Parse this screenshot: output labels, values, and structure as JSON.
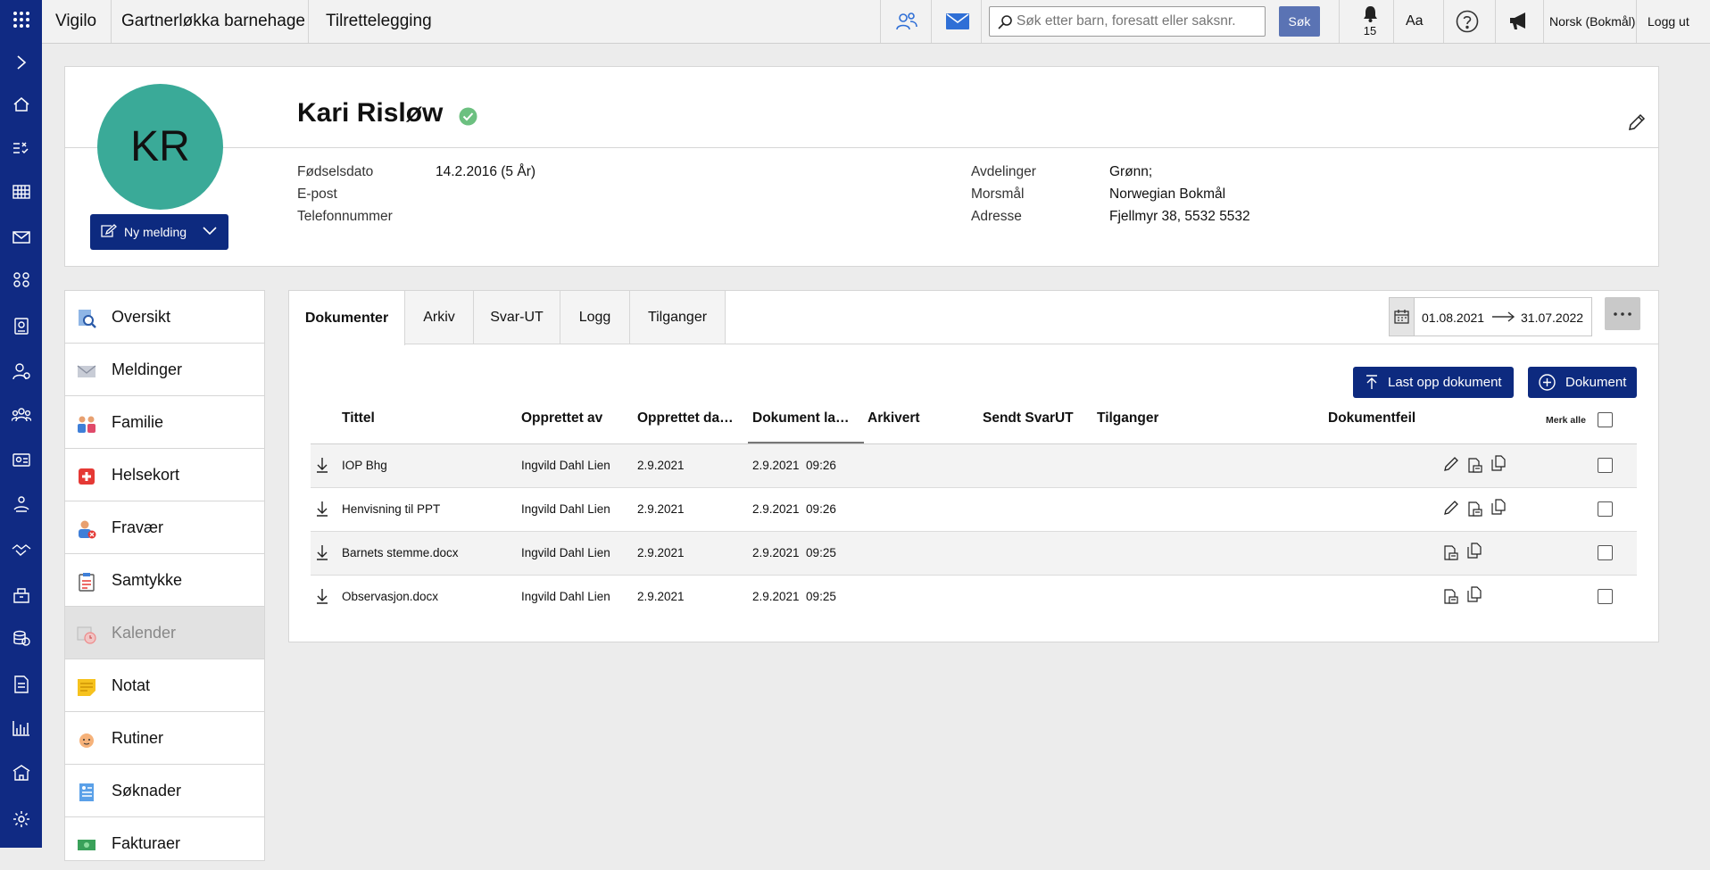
{
  "app": {
    "name": "Vigilo",
    "institution": "Gartnerløkka barnehage",
    "section": "Tilrettelegging"
  },
  "topbar": {
    "search_placeholder": "Søk etter barn, foresatt eller saksnr.",
    "search_button": "Søk",
    "notification_count": "15",
    "font_label": "Aa",
    "language": "Norsk (Bokmål)",
    "logout": "Logg ut"
  },
  "profile": {
    "initials": "KR",
    "name": "Kari Risløw",
    "new_message": "Ny melding",
    "fields_left": [
      {
        "label": "Fødselsdato",
        "value": "14.2.2016 (5 År)"
      },
      {
        "label": "E-post",
        "value": ""
      },
      {
        "label": "Telefonnummer",
        "value": ""
      }
    ],
    "fields_right": [
      {
        "label": "Avdelinger",
        "value": "Grønn;"
      },
      {
        "label": "Morsmål",
        "value": "Norwegian Bokmål"
      },
      {
        "label": "Adresse",
        "value": "Fjellmyr 38, 5532 5532"
      }
    ]
  },
  "menu": [
    {
      "label": "Oversikt",
      "icon": "magnifier-doc-icon"
    },
    {
      "label": "Meldinger",
      "icon": "envelope-icon"
    },
    {
      "label": "Familie",
      "icon": "family-icon"
    },
    {
      "label": "Helsekort",
      "icon": "health-card-icon"
    },
    {
      "label": "Fravær",
      "icon": "absence-icon"
    },
    {
      "label": "Samtykke",
      "icon": "clipboard-icon"
    },
    {
      "label": "Kalender",
      "icon": "calendar-clock-icon"
    },
    {
      "label": "Notat",
      "icon": "note-icon"
    },
    {
      "label": "Rutiner",
      "icon": "baby-icon"
    },
    {
      "label": "Søknader",
      "icon": "application-icon"
    },
    {
      "label": "Fakturaer",
      "icon": "money-icon"
    }
  ],
  "tabs": [
    "Dokumenter",
    "Arkiv",
    "Svar-UT",
    "Logg",
    "Tilganger"
  ],
  "date_range": {
    "from": "01.08.2021",
    "to": "31.07.2022"
  },
  "actions": {
    "upload": "Last opp dokument",
    "document": "Dokument"
  },
  "table": {
    "headers": [
      "Tittel",
      "Opprettet av",
      "Opprettet da…",
      "Dokument la…",
      "Arkivert",
      "Sendt SvarUT",
      "Tilganger",
      "Dokumentfeil"
    ],
    "select_all": "Merk alle",
    "rows": [
      {
        "title": "IOP Bhg",
        "created_by": "Ingvild Dahl Lien",
        "created": "2.9.2021",
        "updated": "2.9.2021  09:26",
        "editable": true
      },
      {
        "title": "Henvisning til PPT",
        "created_by": "Ingvild Dahl Lien",
        "created": "2.9.2021",
        "updated": "2.9.2021  09:26",
        "editable": true
      },
      {
        "title": "Barnets stemme.docx",
        "created_by": "Ingvild Dahl Lien",
        "created": "2.9.2021",
        "updated": "2.9.2021  09:25",
        "editable": false
      },
      {
        "title": "Observasjon.docx",
        "created_by": "Ingvild Dahl Lien",
        "created": "2.9.2021",
        "updated": "2.9.2021  09:25",
        "editable": false
      }
    ]
  }
}
